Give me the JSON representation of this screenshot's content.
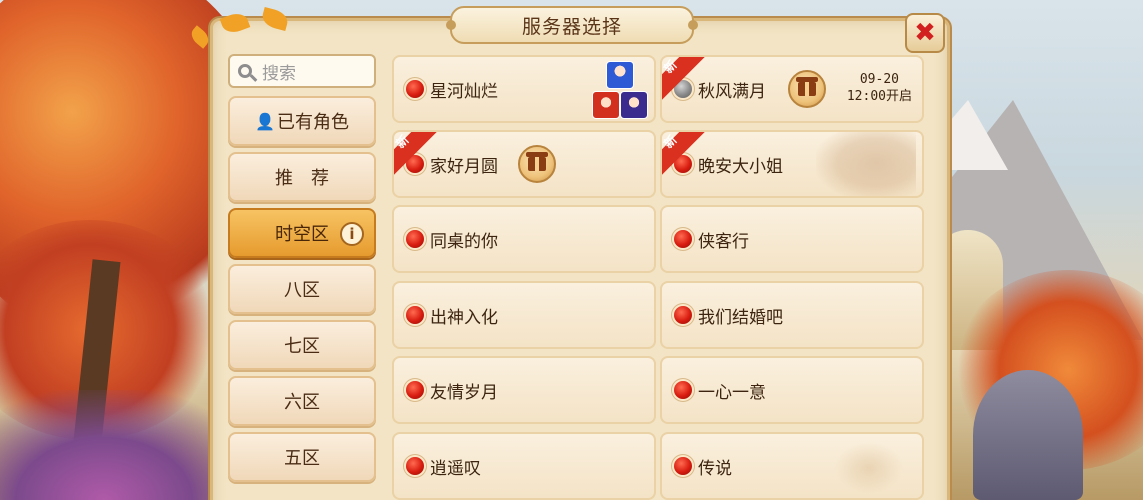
{
  "title": "服务器选择",
  "close_label": "✖",
  "search": {
    "placeholder": "搜索"
  },
  "sidebar": [
    {
      "label": "已有角色",
      "icon": "person-icon",
      "active": false
    },
    {
      "label": "推　荐",
      "active": false
    },
    {
      "label": "时空区",
      "icon": "info-icon",
      "active": true
    },
    {
      "label": "八区",
      "active": false
    },
    {
      "label": "七区",
      "active": false
    },
    {
      "label": "六区",
      "active": false
    },
    {
      "label": "五区",
      "active": false
    }
  ],
  "info_glyph": "i",
  "new_tag": "新",
  "servers": [
    {
      "name": "星河灿烂",
      "status": "red",
      "has_avatars": true
    },
    {
      "name": "秋风满月",
      "status": "gray",
      "is_new": true,
      "has_gift": true,
      "open_date": "09-20",
      "open_time": "12:00开启"
    },
    {
      "name": "家好月圆",
      "status": "red",
      "is_new": true,
      "has_gift": true
    },
    {
      "name": "晚安大小姐",
      "status": "red",
      "is_new": true,
      "has_portrait": true
    },
    {
      "name": "同桌的你",
      "status": "red"
    },
    {
      "name": "侠客行",
      "status": "red"
    },
    {
      "name": "出神入化",
      "status": "red"
    },
    {
      "name": "我们结婚吧",
      "status": "red"
    },
    {
      "name": "友情岁月",
      "status": "red"
    },
    {
      "name": "一心一意",
      "status": "red"
    },
    {
      "name": "逍遥叹",
      "status": "red"
    },
    {
      "name": "传说",
      "status": "red",
      "has_watermark": true
    }
  ],
  "colors": {
    "status_red": "#d81c10",
    "status_gray": "#8a8a8a",
    "active_tab": "#e69b2e",
    "new_tag": "#d9301f"
  }
}
